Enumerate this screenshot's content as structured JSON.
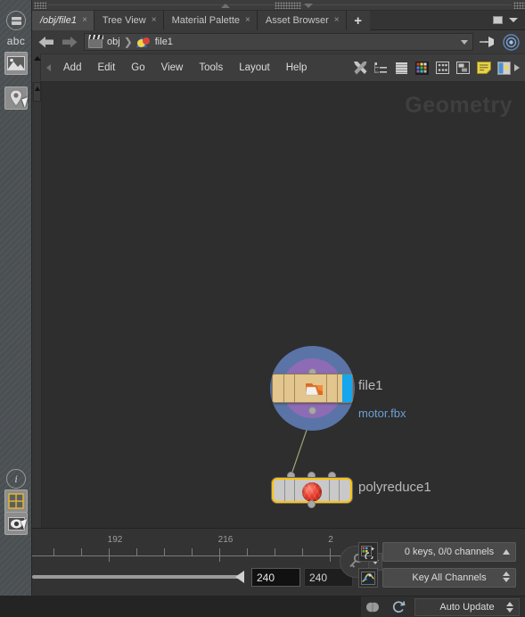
{
  "window": {
    "left_toolbar": [
      {
        "name": "panel-icon",
        "glyph": "▤"
      },
      {
        "name": "abc-label",
        "label": "abc"
      },
      {
        "name": "image-icon",
        "glyph": "🖼"
      },
      {
        "name": "pin-marker-icon",
        "glyph": "📍"
      },
      {
        "name": "info-icon",
        "glyph": "i"
      },
      {
        "name": "grid-layout-icon",
        "glyph": "▦"
      },
      {
        "name": "eye-view-icon",
        "glyph": "◉"
      }
    ]
  },
  "tabs": {
    "items": [
      {
        "label": "/obj/file1",
        "active": true,
        "close": "×"
      },
      {
        "label": "Tree View",
        "active": false,
        "close": "×"
      },
      {
        "label": "Material Palette",
        "active": false,
        "close": "×"
      },
      {
        "label": "Asset Browser",
        "active": false,
        "close": "×"
      }
    ],
    "add_label": "+"
  },
  "pathbar": {
    "back": "◀",
    "forward": "▶",
    "crumbs": [
      {
        "icon": "clapperboard-icon",
        "label": "obj"
      },
      {
        "icon": "geometry-venn-icon",
        "label": "file1"
      }
    ],
    "separator": "❯",
    "dropdown": "▾",
    "pin": "pin-icon",
    "target": "target-icon"
  },
  "menubar": {
    "items": [
      "Add",
      "Edit",
      "Go",
      "View",
      "Tools",
      "Layout",
      "Help"
    ],
    "tools": [
      {
        "name": "tools-wrench-icon",
        "glyph": "✕"
      },
      {
        "name": "tree-list-icon",
        "glyph": "⊟"
      },
      {
        "name": "layers-icon",
        "glyph": "▤"
      },
      {
        "name": "color-palette-icon",
        "glyph": "▦"
      },
      {
        "name": "dots-grid-icon",
        "glyph": "⣿"
      },
      {
        "name": "snapshot-icon",
        "glyph": "▣"
      },
      {
        "name": "notes-icon",
        "glyph": "🗒"
      },
      {
        "name": "image-card-icon",
        "glyph": "🖼"
      },
      {
        "name": "more-arrow-icon",
        "glyph": "▶"
      }
    ]
  },
  "network": {
    "watermark": "Geometry",
    "nodes": [
      {
        "id": "file1",
        "label": "file1",
        "sublabel": "motor.fbx",
        "type": "file",
        "selected": false,
        "display_flag": true,
        "icon": "folder-file-icon"
      },
      {
        "id": "polyreduce1",
        "label": "polyreduce1",
        "sublabel": "",
        "type": "polyreduce",
        "selected": true,
        "display_flag": false,
        "icon": "red-sphere-icon"
      }
    ]
  },
  "timeline": {
    "tick_labels": [
      "192",
      "216",
      "2"
    ],
    "current_frame": "240",
    "end_frame": "240",
    "key_button": "key-icon",
    "key_dropdown": "▾",
    "channels_summary": "0 keys, 0/0 channels",
    "channels_expand": "▲",
    "key_mode": "Key All Channels",
    "key_mode_spinner": "⇕",
    "channel_icon_1": "channel-list-icon",
    "channel_icon_2": "animation-curve-icon"
  },
  "statusbar": {
    "brain_icon": "cook-brain-icon",
    "refresh_icon": "refresh-icon",
    "update_mode": "Auto Update",
    "update_spinner": "⇕"
  }
}
